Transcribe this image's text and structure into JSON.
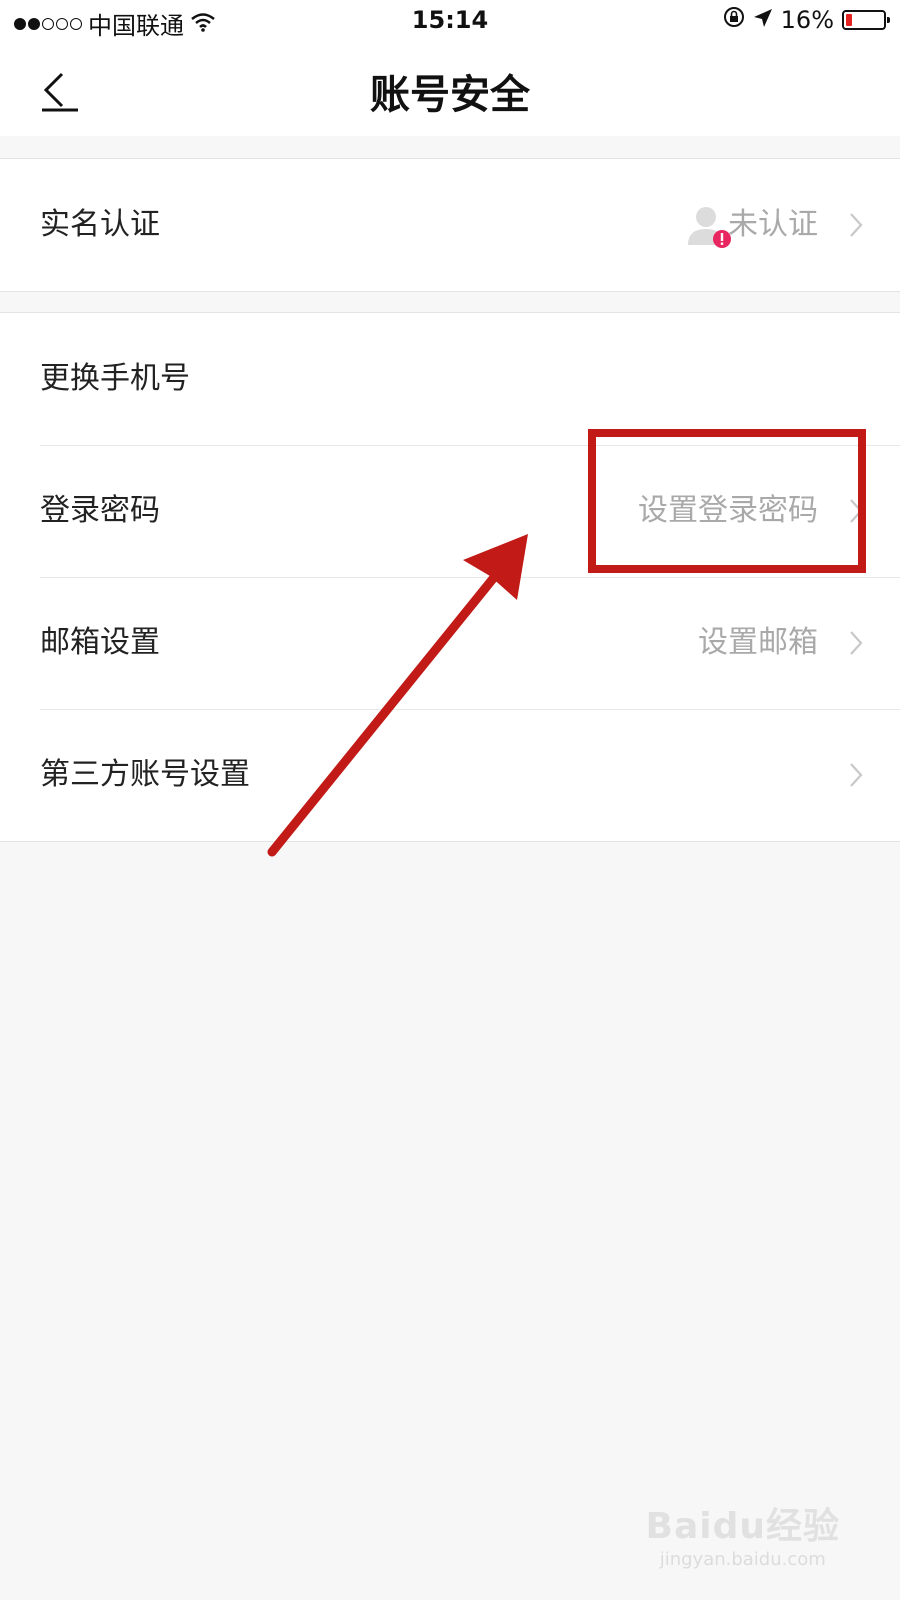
{
  "status_bar": {
    "signal_dots_filled": 2,
    "signal_dots_total": 5,
    "carrier": "中国联通",
    "time": "15:14",
    "battery": "16%",
    "battery_level": 0.16,
    "icons": [
      "wifi-icon",
      "orientation-lock-icon",
      "location-arrow-icon",
      "battery-icon"
    ]
  },
  "navbar": {
    "title": "账号安全",
    "back_icon": "back-arrow-icon"
  },
  "groups": [
    {
      "rows": [
        {
          "label": "实名认证",
          "value": "未认证",
          "icon": "user-unverified-icon"
        }
      ]
    },
    {
      "rows": [
        {
          "label": "更换手机号",
          "value": ""
        },
        {
          "label": "登录密码",
          "value": "设置登录密码"
        },
        {
          "label": "邮箱设置",
          "value": "设置邮箱"
        },
        {
          "label": "第三方账号设置",
          "value": ""
        }
      ]
    }
  ],
  "annotation": {
    "color": "#c21a16",
    "highlighted_item": "登录密码"
  },
  "watermark": {
    "brand": "Baidu经验",
    "domain": "jingyan.baidu.com"
  }
}
